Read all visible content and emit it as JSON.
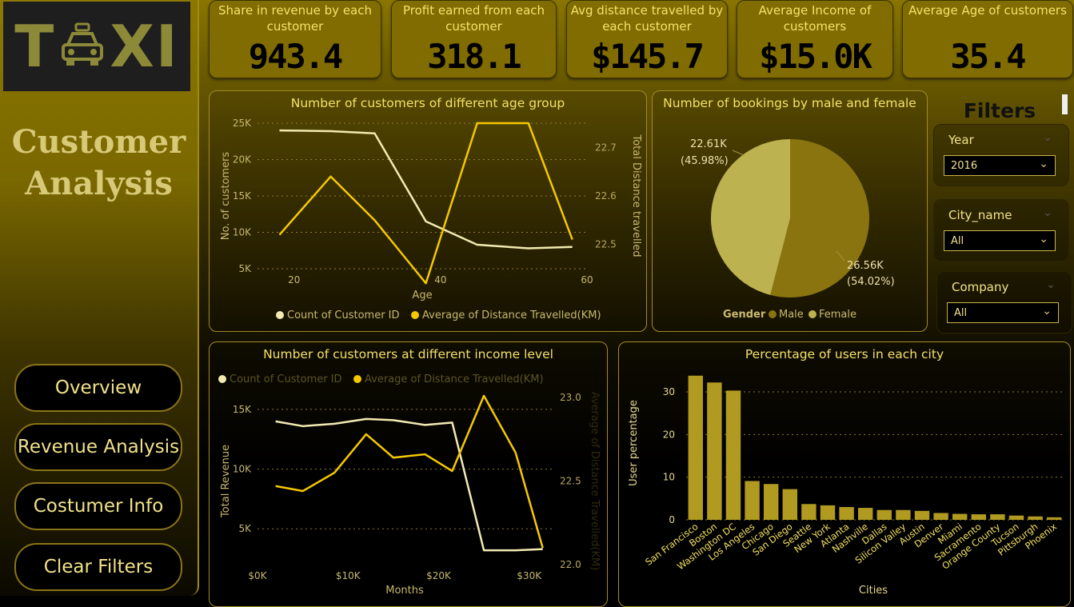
{
  "logo": {
    "text_left": "T",
    "text_right": "XI"
  },
  "page_title": "Customer Analysis",
  "nav": {
    "overview": "Overview",
    "revenue": "Revenue Analysis",
    "customer_info": "Costumer Info",
    "clear": "Clear Filters"
  },
  "kpis": [
    {
      "label": "Share in revenue by each customer",
      "value": "943.4"
    },
    {
      "label": "Profit earned from each customer",
      "value": "318.1"
    },
    {
      "label": "Avg distance travelled by each customer",
      "value": "$145.7"
    },
    {
      "label": "Average Income of customers",
      "value": "$15.0K"
    },
    {
      "label": "Average Age of customers",
      "value": "35.4"
    }
  ],
  "filters": {
    "title": "Filters",
    "items": [
      {
        "label": "Year",
        "value": "2016"
      },
      {
        "label": "City_name",
        "value": "All"
      },
      {
        "label": "Company",
        "value": "All"
      }
    ]
  },
  "colors": {
    "count_line": "#f2eab2",
    "distance_line": "#f5c800",
    "male": "#8a7410",
    "female": "#bdb250",
    "bar": "#b09a20"
  },
  "chart_data": [
    {
      "type": "line",
      "title": "Number of customers of different age group",
      "xlabel": "Age",
      "ylabel": "No. of customers",
      "y2label": "Total Distance travelled",
      "xlim": [
        15,
        60
      ],
      "ylim": [
        5000,
        25000
      ],
      "y2lim": [
        22.45,
        22.75
      ],
      "x_ticks": [
        "20",
        "40",
        "60"
      ],
      "y_ticks": [
        "5K",
        "10K",
        "15K",
        "20K",
        "25K"
      ],
      "y2_ticks": [
        "22.5",
        "22.6",
        "22.7"
      ],
      "legend": [
        "Count of Customer ID",
        "Average of Distance Travelled(KM)"
      ],
      "series": [
        {
          "name": "Count of Customer ID",
          "axis": "left",
          "x": [
            18,
            25,
            31,
            38,
            45,
            52,
            58
          ],
          "values": [
            24000,
            23900,
            23600,
            11500,
            8300,
            7800,
            8000
          ]
        },
        {
          "name": "Average of Distance Travelled(KM)",
          "axis": "right",
          "x": [
            18,
            25,
            31,
            38,
            45,
            52,
            58
          ],
          "values": [
            22.52,
            22.64,
            22.55,
            22.42,
            22.75,
            22.75,
            22.51
          ]
        }
      ]
    },
    {
      "type": "pie",
      "title": "Number of bookings by male and female",
      "legend_title": "Gender",
      "slices": [
        {
          "name": "Male",
          "value": 26.56,
          "label": "26.56K",
          "pct": "(54.02%)"
        },
        {
          "name": "Female",
          "value": 22.61,
          "label": "22.61K",
          "pct": "(45.98%)"
        }
      ]
    },
    {
      "type": "line",
      "title": "Number of customers at different income level",
      "xlabel": "Months",
      "ylabel": "Total Revenue",
      "y2label": "Average of Distance Travelled(KM)",
      "xlim": [
        0,
        32500
      ],
      "ylim": [
        2000,
        16000
      ],
      "y2lim": [
        22.0,
        23.0
      ],
      "x_ticks": [
        "$0K",
        "$10K",
        "$20K",
        "$30K"
      ],
      "y_ticks": [
        "5K",
        "10K",
        "15K"
      ],
      "y2_ticks": [
        "22.0",
        "22.5",
        "23.0"
      ],
      "legend": [
        "Count of Customer ID",
        "Average of Distance Travelled(KM)"
      ],
      "series": [
        {
          "name": "Count of Customer ID",
          "axis": "left",
          "x": [
            2000,
            5000,
            8500,
            12000,
            15000,
            18500,
            21500,
            25000,
            28500,
            31500
          ],
          "values": [
            14000,
            13600,
            13800,
            14200,
            14100,
            13700,
            13900,
            3200,
            3200,
            3300
          ]
        },
        {
          "name": "Average of Distance Travelled(KM)",
          "axis": "right",
          "x": [
            2000,
            5000,
            8500,
            12000,
            15000,
            18500,
            21500,
            25000,
            28500,
            31500
          ],
          "values": [
            22.47,
            22.44,
            22.55,
            22.78,
            22.64,
            22.66,
            22.56,
            23.01,
            22.67,
            22.1
          ]
        }
      ]
    },
    {
      "type": "bar",
      "title": "Percentage of users in each city",
      "xlabel": "Cities",
      "ylabel": "User percentage",
      "ylim": [
        0,
        36
      ],
      "y_ticks": [
        "0",
        "10",
        "20",
        "30"
      ],
      "categories": [
        "San Francisco",
        "Boston",
        "Washington DC",
        "Los Angeles",
        "Chicago",
        "San Diego",
        "Seattle",
        "New York",
        "Atlanta",
        "Nashville",
        "Dallas",
        "Silicon Valley",
        "Austin",
        "Denver",
        "Miami",
        "Sacramento",
        "Orange County",
        "Tucson",
        "Pittsburgh",
        "Phoenix"
      ],
      "values": [
        33.8,
        32.2,
        30.3,
        9.1,
        8.4,
        7.2,
        3.7,
        3.4,
        3.0,
        2.8,
        2.3,
        2.3,
        2.1,
        1.6,
        1.4,
        1.3,
        1.3,
        1.0,
        0.8,
        0.6
      ]
    }
  ]
}
